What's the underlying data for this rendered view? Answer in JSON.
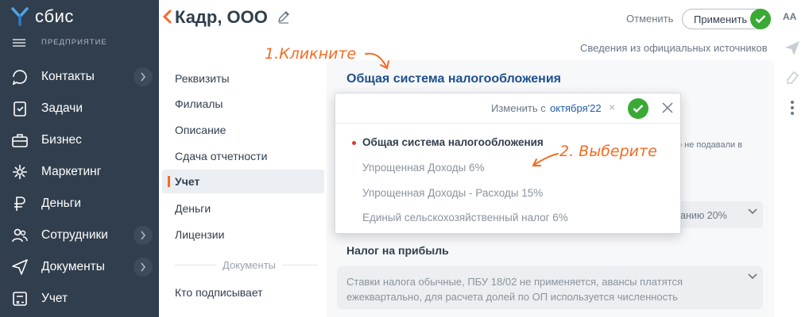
{
  "app": {
    "logo_text": "сбис"
  },
  "sidebar": {
    "menu_header": "ПРЕДПРИЯТИЕ",
    "items": [
      {
        "label": "Контакты",
        "icon": "contacts-icon",
        "has_arrow": true
      },
      {
        "label": "Задачи",
        "icon": "tasks-icon",
        "has_arrow": false
      },
      {
        "label": "Бизнес",
        "icon": "business-icon",
        "has_arrow": false
      },
      {
        "label": "Маркетинг",
        "icon": "marketing-icon",
        "has_arrow": false
      },
      {
        "label": "Деньги",
        "icon": "money-icon",
        "has_arrow": false
      },
      {
        "label": "Сотрудники",
        "icon": "employees-icon",
        "has_arrow": true
      },
      {
        "label": "Документы",
        "icon": "documents-icon",
        "has_arrow": true
      },
      {
        "label": "Учет",
        "icon": "accounting-icon",
        "has_arrow": false
      }
    ]
  },
  "header": {
    "title": "Кадр, ООО",
    "cancel_label": "Отменить",
    "apply_label": "Применить",
    "aa_label": "АА",
    "official_sources_link": "Сведения из официальных источников"
  },
  "sections": {
    "items": [
      "Реквизиты",
      "Филиалы",
      "Описание",
      "Сдача отчетности",
      "Учет",
      "Деньги",
      "Лицензии"
    ],
    "active_index": 4,
    "divider_label": "Документы",
    "after_divider": [
      "Кто подписывает"
    ]
  },
  "content": {
    "tax_system_title": "Общая система налогообложения",
    "side_note": "о не подавали в",
    "vat_value": "анию 20%",
    "profit_tax_title": "Налог на прибыль",
    "profit_tax_text": "Ставки налога обычные, ПБУ 18/02 не применяется, авансы платятся ежеквартально, для расчета долей по ОП используется численность"
  },
  "dropdown": {
    "change_from_label": "Изменить с",
    "change_from_date": "октября'22",
    "options": [
      "Общая система налогообложения",
      "Упрощенная Доходы 6%",
      "Упрощенная Доходы - Расходы 15%",
      "Единый сельскохозяйственный налог 6%"
    ],
    "selected_index": 0
  },
  "annotations": {
    "step1": "1.Кликните",
    "step2": "2. Выберите"
  },
  "colors": {
    "sidebar_bg": "#313e4d",
    "accent_orange": "#f76a24",
    "success_green": "#3aa935",
    "link_blue": "#1e4f8c",
    "annotation_orange": "#f56b22"
  }
}
